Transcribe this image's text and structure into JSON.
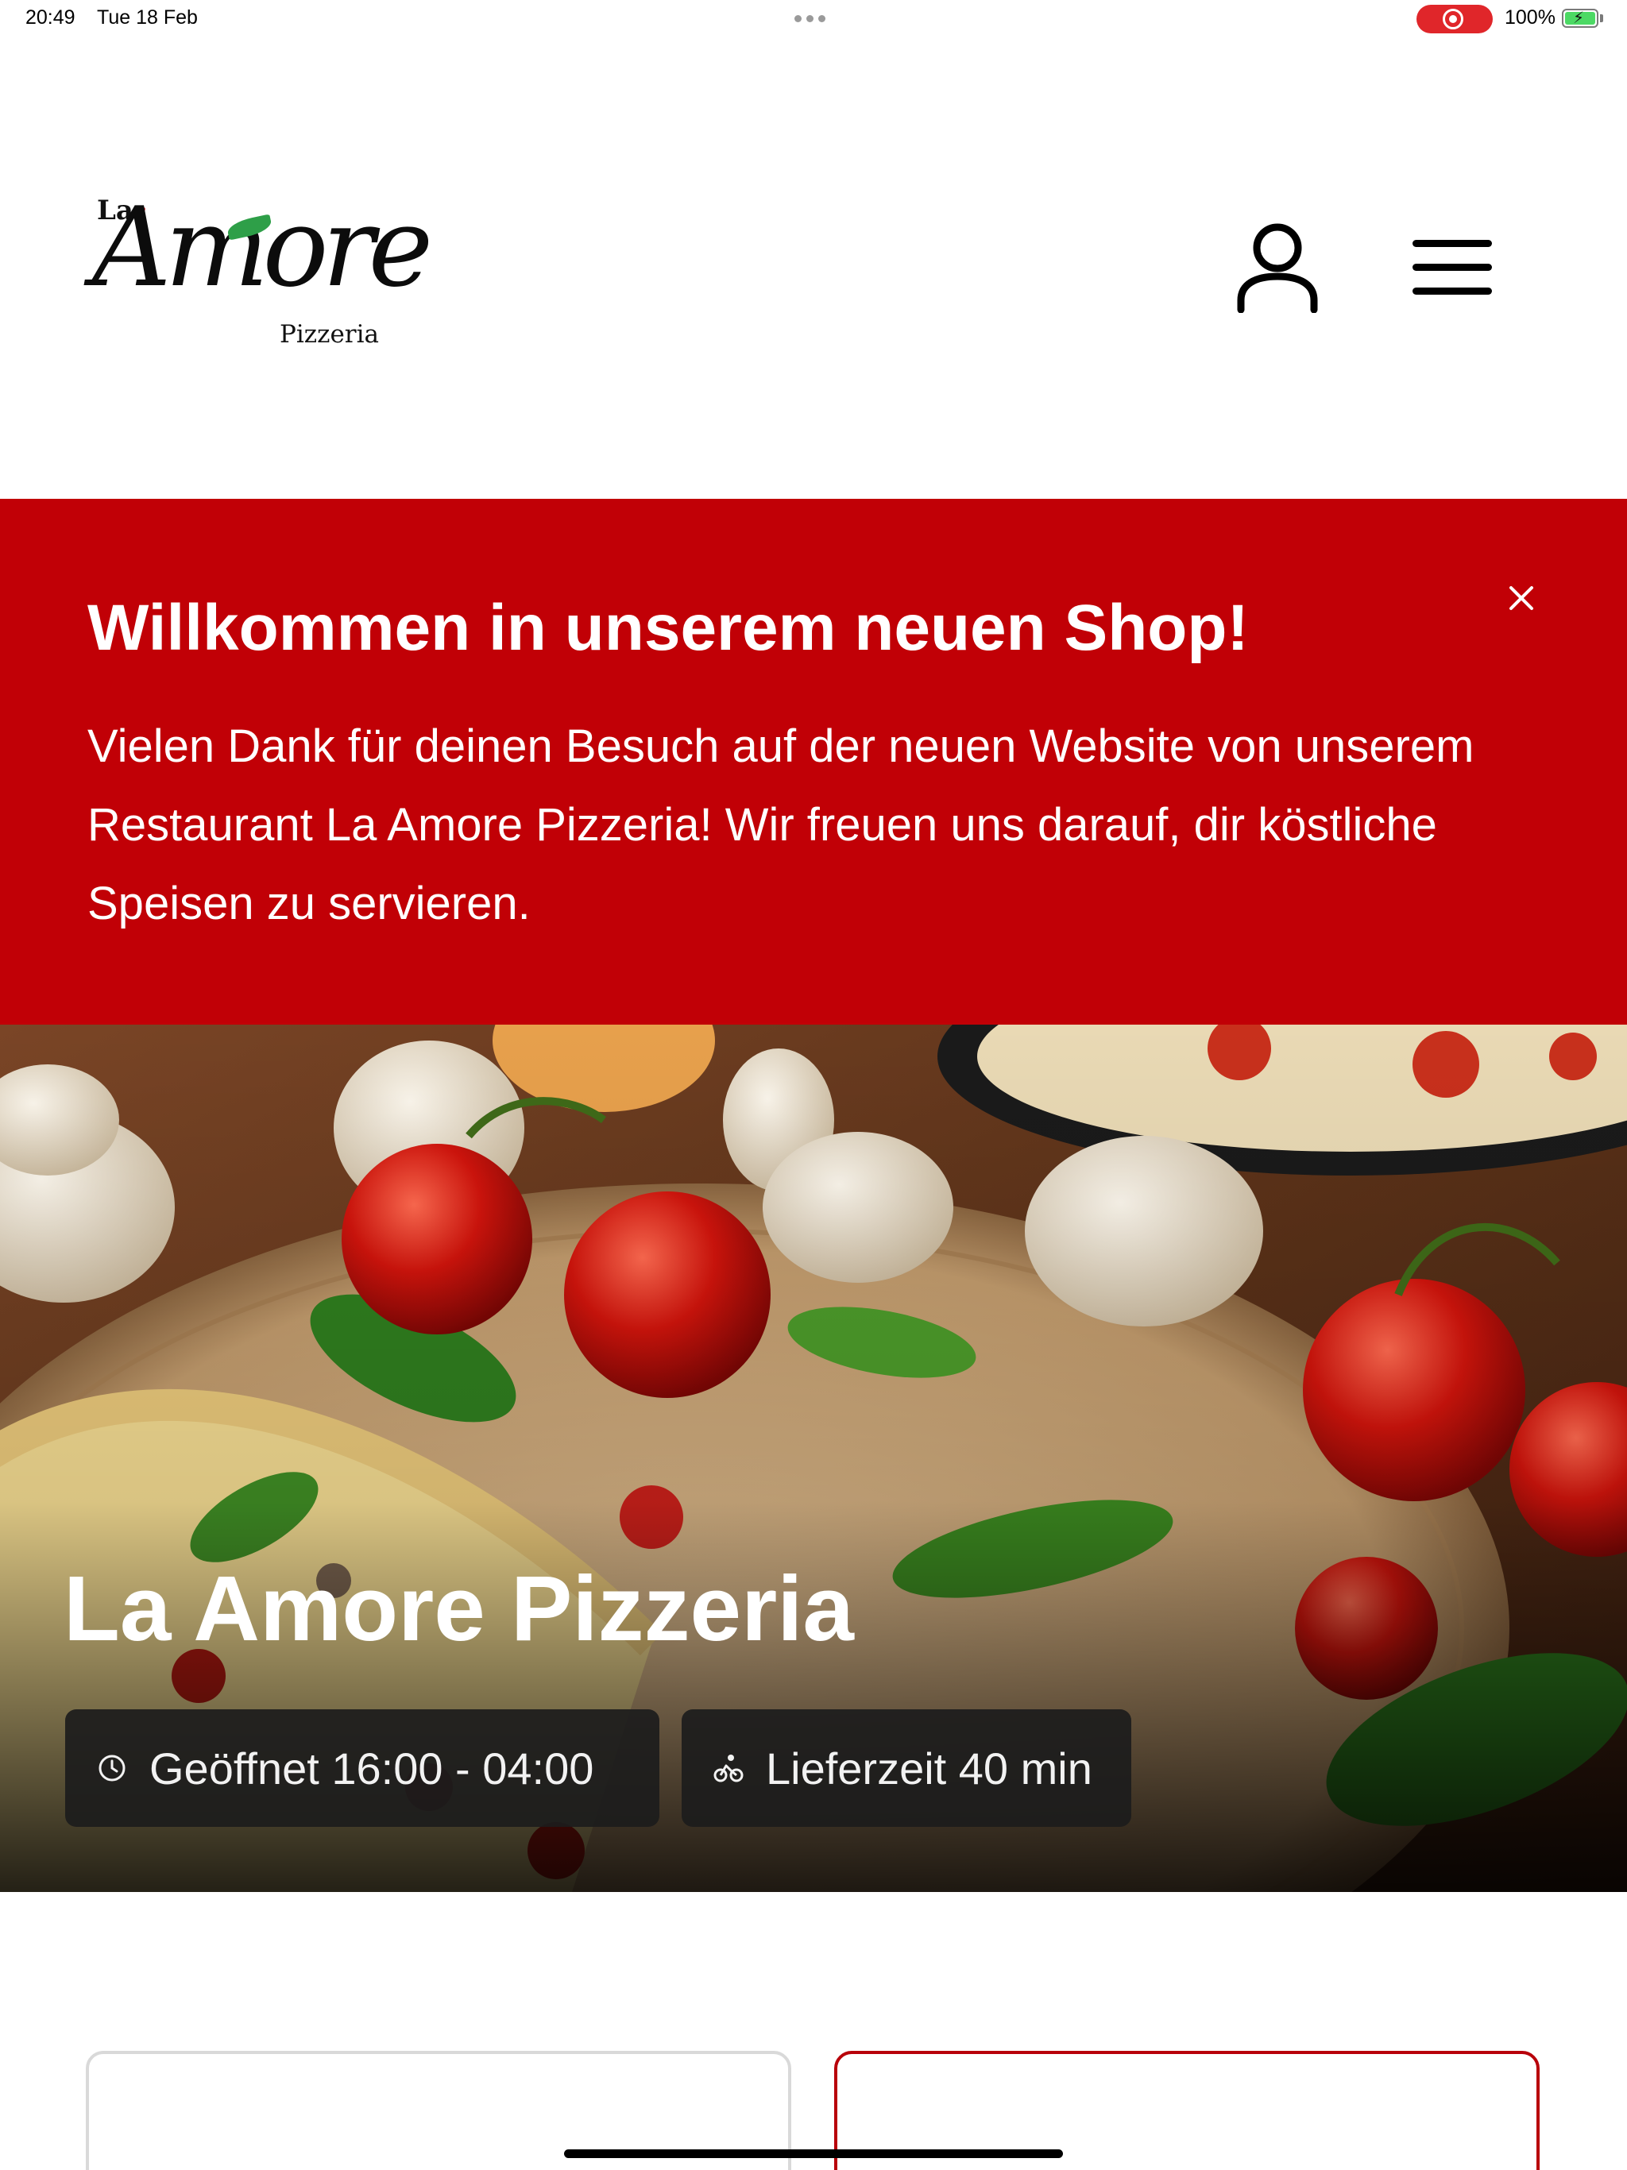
{
  "status_bar": {
    "time": "20:49",
    "date": "Tue 18 Feb",
    "battery": "100%"
  },
  "header": {
    "logo": {
      "la": "La",
      "name": "Amore",
      "sub": "Pizzeria"
    }
  },
  "banner": {
    "title": "Willkommen in unserem neuen Shop!",
    "text": "Vielen Dank für deinen Besuch auf der neuen Website von unserem Restaurant La Amore Pizzeria! Wir freuen uns darauf, dir köstliche Speisen zu servieren."
  },
  "hero": {
    "title": "La Amore Pizzeria",
    "open_text": "Geöffnet 16:00 - 04:00",
    "delivery_text": "Lieferzeit 40 min"
  },
  "colors": {
    "brand_red": "#c10006",
    "card_border_active": "#b8000a",
    "card_border": "#d9d9d9"
  },
  "icons": [
    "user-icon",
    "hamburger-menu-icon",
    "close-icon",
    "clock-icon",
    "delivery-bike-icon"
  ]
}
